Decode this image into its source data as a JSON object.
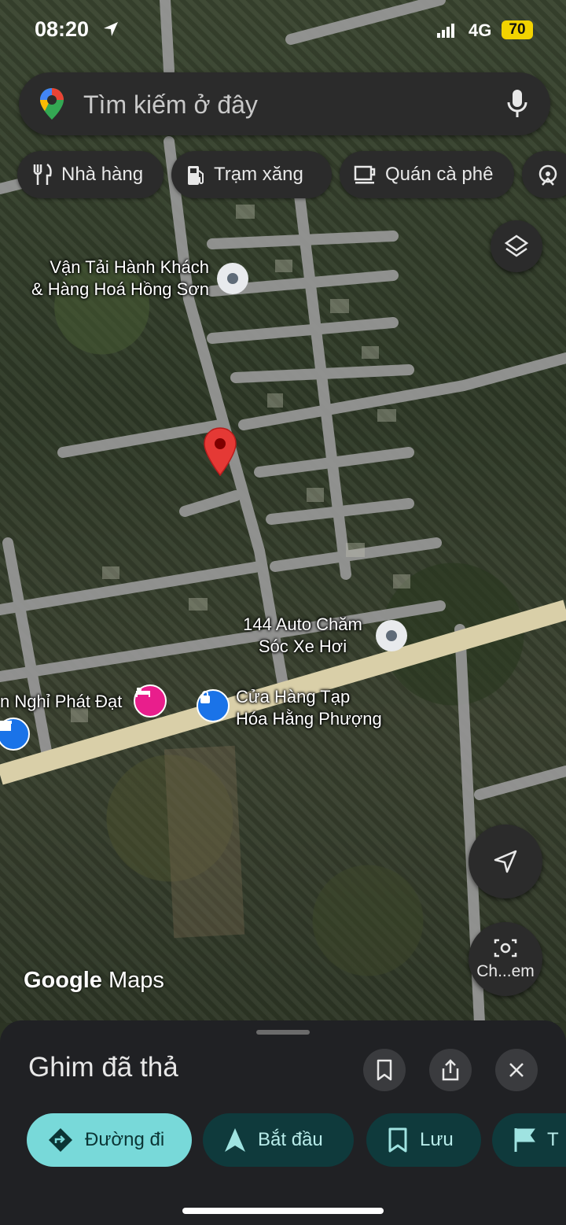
{
  "status_bar": {
    "time": "08:20",
    "network": "4G",
    "battery": "70"
  },
  "search": {
    "placeholder": "Tìm kiếm ở đây"
  },
  "chips": [
    {
      "label": "Nhà hàng",
      "icon": "fork-knife-icon"
    },
    {
      "label": "Trạm xăng",
      "icon": "gas-pump-icon"
    },
    {
      "label": "Quán cà phê",
      "icon": "coffee-cup-icon"
    }
  ],
  "map": {
    "labels": {
      "poi1": "Vận Tải Hành Khách\n& Hàng Hoá Hồng Sơn",
      "poi2": "144 Auto Chăm\nSóc Xe Hơi",
      "poi3": "Cửa Hàng Tạp\nHóa Hằng Phượng",
      "poi4": "n Nghỉ Phát Đạt"
    },
    "watermark_brand": "Google",
    "watermark_product": "Maps",
    "camera_button_label": "Ch...em"
  },
  "sheet": {
    "title": "Ghim đã thả",
    "actions": [
      {
        "label": "Đường đi",
        "icon": "directions-icon"
      },
      {
        "label": "Bắt đầu",
        "icon": "navigation-arrow-icon"
      },
      {
        "label": "Lưu",
        "icon": "bookmark-icon"
      },
      {
        "label": "T",
        "icon": "flag-icon"
      }
    ]
  },
  "colors": {
    "accent": "#78d9d9",
    "pin": "#e53935",
    "dark_chip": "#0f3a3c"
  }
}
